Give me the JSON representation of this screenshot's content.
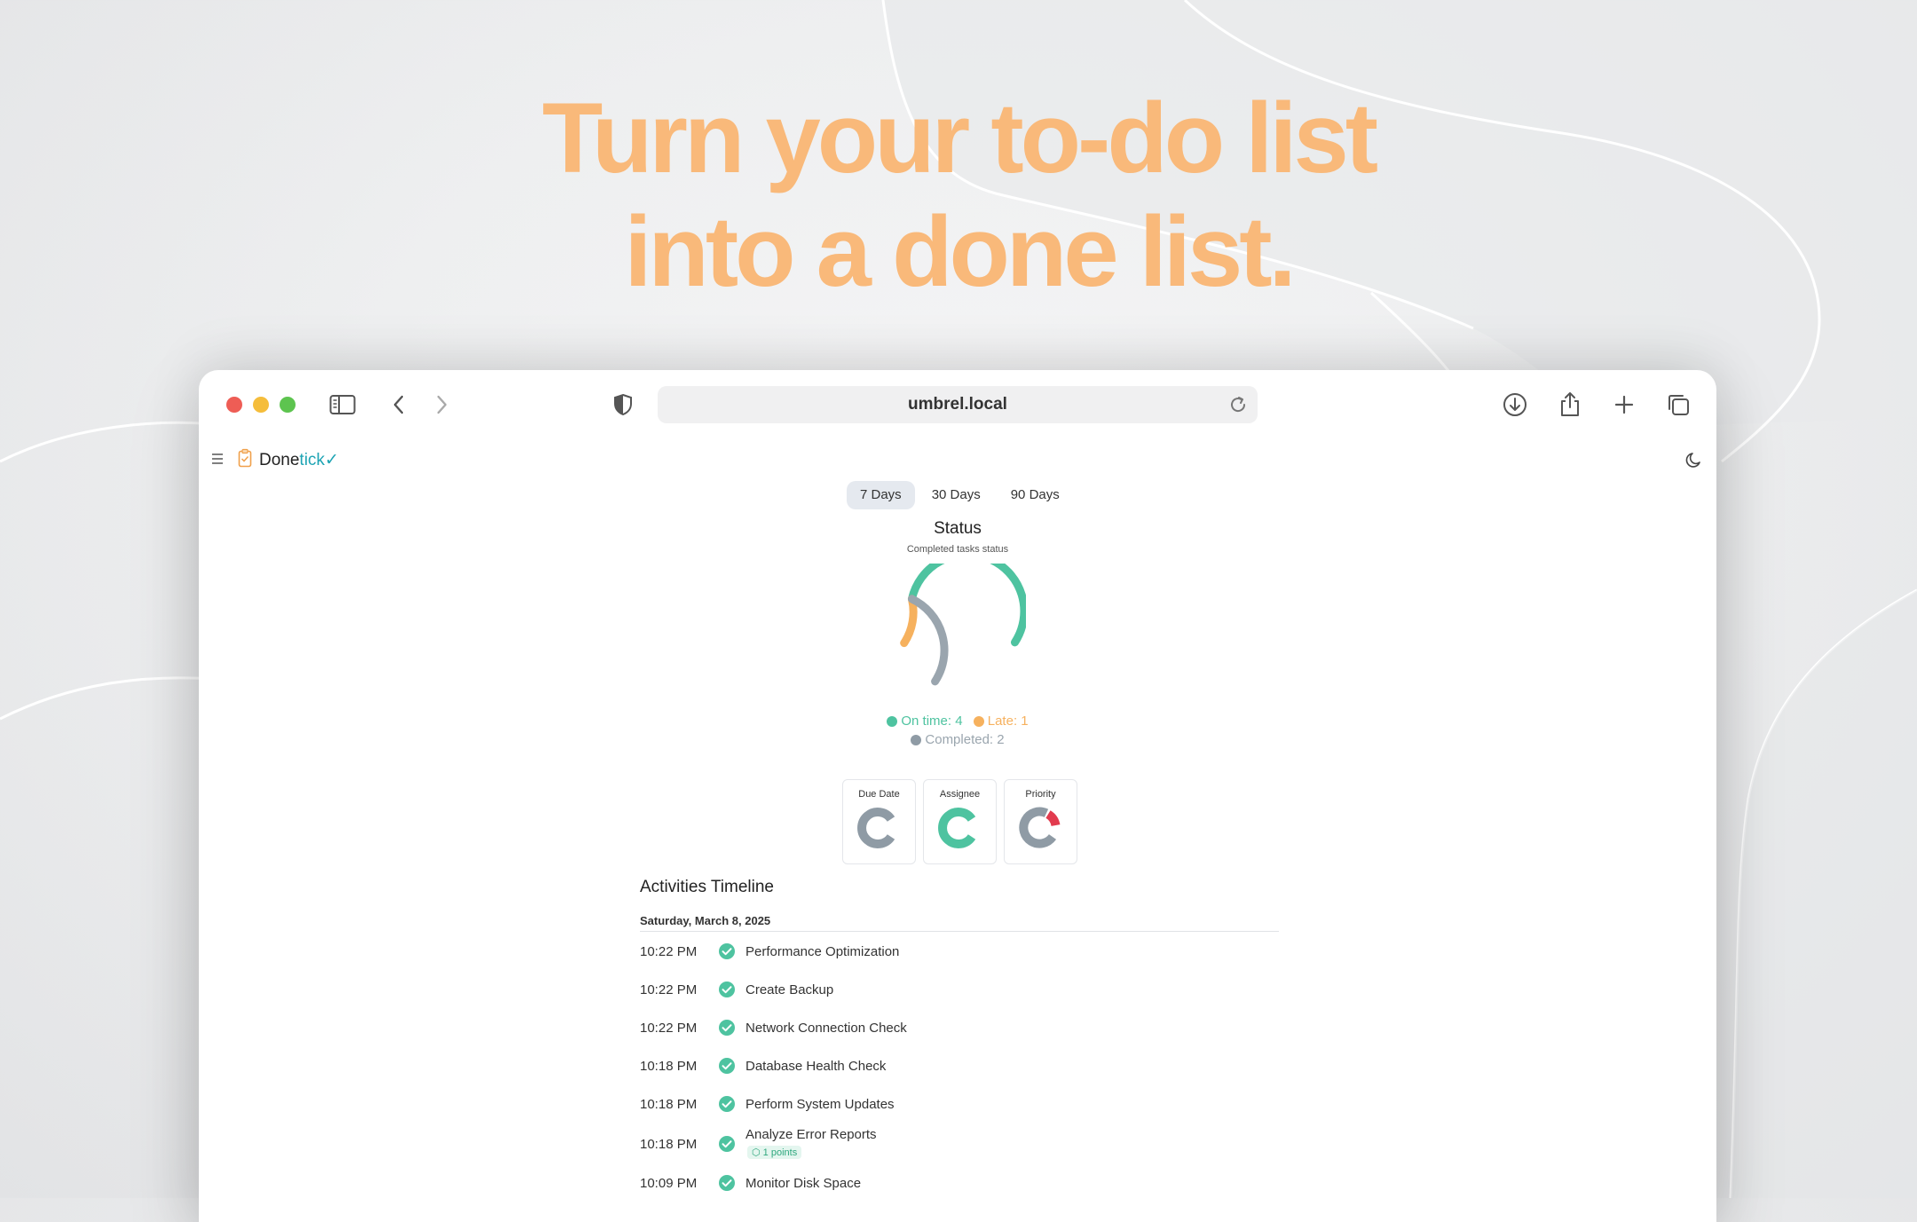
{
  "headline": {
    "line1": "Turn your to-do list",
    "line2": "into a done list.",
    "color": "#f9b97a"
  },
  "browser": {
    "url": "umbrel.local",
    "icons": [
      "sidebar-icon",
      "back-icon",
      "forward-icon",
      "shield-icon",
      "reload-icon",
      "download-icon",
      "share-icon",
      "new-tab-icon",
      "tabs-overview-icon"
    ]
  },
  "app": {
    "brand_main": "Done",
    "brand_accent": "tick",
    "brand_check": "✓"
  },
  "range_tabs": [
    {
      "label": "7 Days",
      "active": true
    },
    {
      "label": "30 Days",
      "active": false
    },
    {
      "label": "90 Days",
      "active": false
    }
  ],
  "status": {
    "title": "Status",
    "subtitle": "Completed tasks status",
    "legend": {
      "on_time": "On time: 4",
      "late": "Late: 1",
      "completed": "Completed: 2"
    },
    "colors": {
      "on_time": "#4ec3a0",
      "late": "#f6b15e",
      "completed": "#9aa5ae"
    }
  },
  "chart_data": {
    "type": "pie",
    "categories": [
      "On time",
      "Late",
      "Completed"
    ],
    "values": [
      4,
      1,
      2
    ]
  },
  "cards": [
    {
      "label": "Due Date",
      "color": "#8f9ba5",
      "accent": ""
    },
    {
      "label": "Assignee",
      "color": "#4ec3a0",
      "accent": ""
    },
    {
      "label": "Priority",
      "color": "#8f9ba5",
      "accent": "#e23b4e"
    }
  ],
  "timeline": {
    "title": "Activities Timeline",
    "date": "Saturday, March 8, 2025",
    "items": [
      {
        "time": "10:22 PM",
        "name": "Performance Optimization"
      },
      {
        "time": "10:22 PM",
        "name": "Create Backup"
      },
      {
        "time": "10:22 PM",
        "name": "Network Connection Check"
      },
      {
        "time": "10:18 PM",
        "name": "Database Health Check"
      },
      {
        "time": "10:18 PM",
        "name": "Perform System Updates"
      },
      {
        "time": "10:18 PM",
        "name": "Analyze Error Reports",
        "badge": "1 points"
      },
      {
        "time": "10:09 PM",
        "name": "Monitor Disk Space"
      }
    ]
  }
}
